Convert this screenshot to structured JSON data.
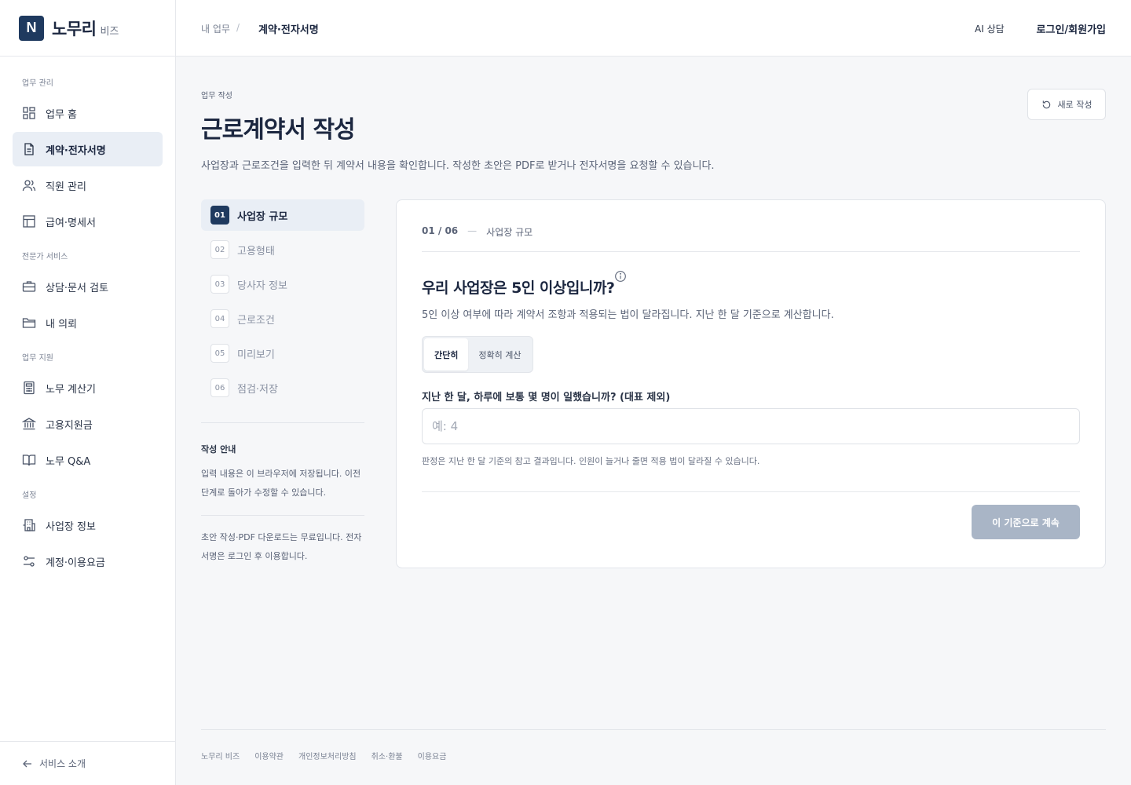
{
  "brand": {
    "logo_letter": "N",
    "name": "노무리",
    "sub": "비즈"
  },
  "sidebar": {
    "sections": [
      {
        "title": "업무 관리",
        "items": [
          {
            "label": "업무 홈",
            "icon": "grid-icon"
          },
          {
            "label": "계약·전자서명",
            "icon": "document-icon",
            "active": true
          },
          {
            "label": "직원 관리",
            "icon": "users-icon"
          },
          {
            "label": "급여·명세서",
            "icon": "table-icon"
          }
        ]
      },
      {
        "title": "전문가 서비스",
        "items": [
          {
            "label": "상담·문서 검토",
            "icon": "briefcase-icon"
          },
          {
            "label": "내 의뢰",
            "icon": "folder-icon"
          }
        ]
      },
      {
        "title": "업무 지원",
        "items": [
          {
            "label": "노무 계산기",
            "icon": "calculator-icon"
          },
          {
            "label": "고용지원금",
            "icon": "bank-icon"
          },
          {
            "label": "노무 Q&A",
            "icon": "book-icon"
          }
        ]
      },
      {
        "title": "설정",
        "items": [
          {
            "label": "사업장 정보",
            "icon": "building-icon"
          },
          {
            "label": "계정·이용요금",
            "icon": "settings-sliders-icon"
          }
        ]
      }
    ],
    "footer_label": "서비스 소개"
  },
  "topbar": {
    "breadcrumb": [
      "내 업무",
      "계약·전자서명"
    ],
    "breadcrumb_sep": "/",
    "ai_label": "AI 상담",
    "login_label": "로그인/회원가입"
  },
  "page": {
    "eyebrow": "업무 작성",
    "title": "근로계약서 작성",
    "description": "사업장과 근로조건을 입력한 뒤 계약서 내용을 확인합니다. 작성한 초안은 PDF로 받거나 전자서명을 요청할 수 있습니다.",
    "reset_label": "새로 작성"
  },
  "steps": [
    {
      "num": "01",
      "label": "사업장 규모",
      "active": true
    },
    {
      "num": "02",
      "label": "고용형태"
    },
    {
      "num": "03",
      "label": "당사자 정보"
    },
    {
      "num": "04",
      "label": "근로조건"
    },
    {
      "num": "05",
      "label": "미리보기"
    },
    {
      "num": "06",
      "label": "점검·저장"
    }
  ],
  "guide": {
    "title": "작성 안내",
    "text1": "입력 내용은 이 브라우저에 저장됩니다. 이전 단계로 돌아가 수정할 수 있습니다.",
    "text2": "초안 작성·PDF 다운로드는 무료입니다. 전자서명은 로그인 후 이용합니다."
  },
  "card": {
    "step_counter": "01 / 06",
    "step_dash": "—",
    "step_name": "사업장 규모",
    "question": "우리 사업장은 5인 이상입니까?",
    "question_desc": "5인 이상 여부에 따라 계약서 조항과 적용되는 법이 달라집니다. 지난 한 달 기준으로 계산합니다.",
    "modes": [
      "간단히",
      "정확히 계산"
    ],
    "selected_mode": "간단히",
    "field_label": "지난 한 달, 하루에 보통 몇 명이 일했습니까? (대표 제외)",
    "field_value": "",
    "field_placeholder": "예: 4",
    "field_help": "판정은 지난 한 달 기준의 참고 결과입니다. 인원이 늘거나 줄면 적용 법이 달라질 수 있습니다.",
    "continue_label": "이 기준으로 계속"
  },
  "footer": {
    "links": [
      "노무리 비즈",
      "이용약관",
      "개인정보처리방침",
      "취소·환불",
      "이용요금"
    ]
  },
  "colors": {
    "brand": "#1f3a5f",
    "active_bg": "#e9eef5",
    "disabled_button": "#a9b5c6",
    "page_bg": "#f6f7f9"
  }
}
